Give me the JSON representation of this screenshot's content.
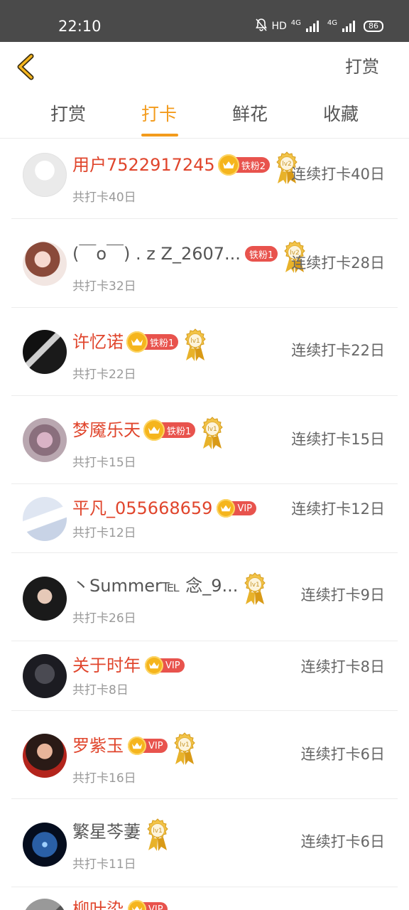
{
  "status_bar": {
    "time": "22:10",
    "hd_label": "HD",
    "network_1": "4G",
    "network_2": "4G",
    "battery": "86"
  },
  "header": {
    "back_icon": "chevron-left-icon",
    "action_label": "打赏",
    "accent_color": "#f39b1c"
  },
  "tabs": [
    {
      "label": "打赏",
      "active": false
    },
    {
      "label": "打卡",
      "active": true
    },
    {
      "label": "鲜花",
      "active": false
    },
    {
      "label": "收藏",
      "active": false
    }
  ],
  "rows": [
    {
      "name": "用户7522917245",
      "name_color": "red",
      "badge": "铁粉2",
      "badge_type": "fan",
      "medal": "lv2",
      "total": "共打卡40日",
      "streak": "连续打卡40日"
    },
    {
      "name": "(￣o￣) . z Z_2607...",
      "name_color": "gray",
      "badge": "铁粉1",
      "badge_type": "fan-plain",
      "medal": "lv2",
      "total": "共打卡32日",
      "streak": "连续打卡28日"
    },
    {
      "name": "许忆诺",
      "name_color": "red",
      "badge": "铁粉1",
      "badge_type": "fan",
      "medal": "lv1",
      "total": "共打卡22日",
      "streak": "连续打卡22日"
    },
    {
      "name": "梦魇乐天",
      "name_color": "red",
      "badge": "铁粉1",
      "badge_type": "fan",
      "medal": "lv1",
      "total": "共打卡15日",
      "streak": "连续打卡15日"
    },
    {
      "name": "平凡_055668659",
      "name_color": "red",
      "badge": "VIP",
      "badge_type": "vip",
      "medal": "",
      "total": "共打卡12日",
      "streak": "连续打卡12日"
    },
    {
      "name": "丶Summer℡ 念_9...",
      "name_color": "gray",
      "badge": "",
      "badge_type": "",
      "medal": "lv1",
      "total": "共打卡26日",
      "streak": "连续打卡9日"
    },
    {
      "name": "关于时年",
      "name_color": "red",
      "badge": "VIP",
      "badge_type": "vip",
      "medal": "",
      "total": "共打卡8日",
      "streak": "连续打卡8日"
    },
    {
      "name": "罗紫玉",
      "name_color": "red",
      "badge": "VIP",
      "badge_type": "vip",
      "medal": "lv1",
      "total": "共打卡16日",
      "streak": "连续打卡6日"
    },
    {
      "name": "繁星芩萋",
      "name_color": "gray",
      "badge": "",
      "badge_type": "",
      "medal": "lv1",
      "total": "共打卡11日",
      "streak": "连续打卡6日"
    },
    {
      "name": "柳叶染",
      "name_color": "red",
      "badge": "VIP",
      "badge_type": "vip",
      "medal": "",
      "total": "",
      "streak": ""
    }
  ]
}
